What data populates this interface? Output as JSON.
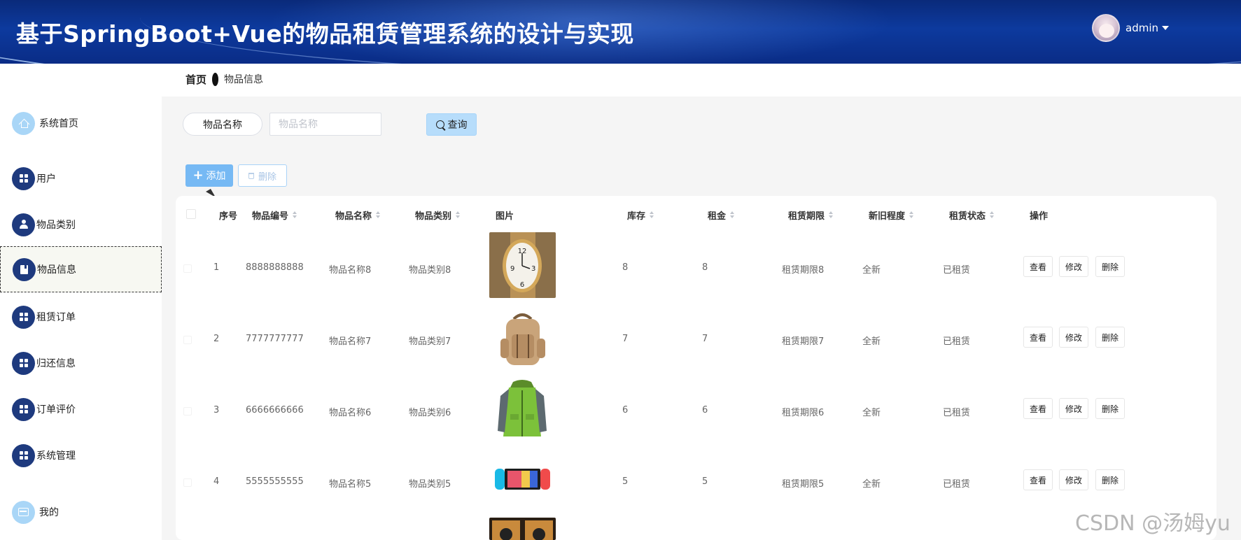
{
  "header": {
    "title": "基于SpringBoot+Vue的物品租赁管理系统的设计与实现",
    "username": "admin"
  },
  "breadcrumb": {
    "home": "首页",
    "current": "物品信息"
  },
  "sidebar": {
    "items": [
      {
        "label": "系统首页",
        "icon": "home-icon"
      },
      {
        "label": "用户",
        "icon": "grid-icon"
      },
      {
        "label": "物品类别",
        "icon": "person-icon"
      },
      {
        "label": "物品信息",
        "icon": "book-icon",
        "active": true
      },
      {
        "label": "租赁订单",
        "icon": "grid-icon"
      },
      {
        "label": "归还信息",
        "icon": "grid-icon"
      },
      {
        "label": "订单评价",
        "icon": "grid-icon"
      },
      {
        "label": "系统管理",
        "icon": "grid-icon"
      },
      {
        "label": "我的",
        "icon": "wallet-icon"
      }
    ]
  },
  "search": {
    "label": "物品名称",
    "placeholder": "物品名称",
    "value": "",
    "button": "查询"
  },
  "actions": {
    "add": "添加",
    "delete": "删除"
  },
  "table": {
    "columns": [
      "序号",
      "物品编号",
      "物品名称",
      "物品类别",
      "图片",
      "库存",
      "租金",
      "租赁期限",
      "新旧程度",
      "租赁状态",
      "操作"
    ],
    "row_actions": {
      "view": "查看",
      "edit": "修改",
      "delete": "删除"
    },
    "rows": [
      {
        "index": "1",
        "code": "8888888888",
        "name": "物品名称8",
        "category": "物品类别8",
        "image": "watch-image",
        "stock": "8",
        "rent": "8",
        "period": "租赁期限8",
        "condition": "全新",
        "status": "已租赁"
      },
      {
        "index": "2",
        "code": "7777777777",
        "name": "物品名称7",
        "category": "物品类别7",
        "image": "backpack-image",
        "stock": "7",
        "rent": "7",
        "period": "租赁期限7",
        "condition": "全新",
        "status": "已租赁"
      },
      {
        "index": "3",
        "code": "6666666666",
        "name": "物品名称6",
        "category": "物品类别6",
        "image": "jacket-image",
        "stock": "6",
        "rent": "6",
        "period": "租赁期限6",
        "condition": "全新",
        "status": "已租赁"
      },
      {
        "index": "4",
        "code": "5555555555",
        "name": "物品名称5",
        "category": "物品类别5",
        "image": "game-console-image",
        "stock": "5",
        "rent": "5",
        "period": "租赁期限5",
        "condition": "全新",
        "status": "已租赁"
      }
    ]
  },
  "watermark": "CSDN @汤姆yu",
  "colors": {
    "header_bg": "#0d3a9e",
    "sidebar_icon": "#1e3a7e",
    "primary": "#76b9f4",
    "query_btn": "#b7ddfb"
  }
}
